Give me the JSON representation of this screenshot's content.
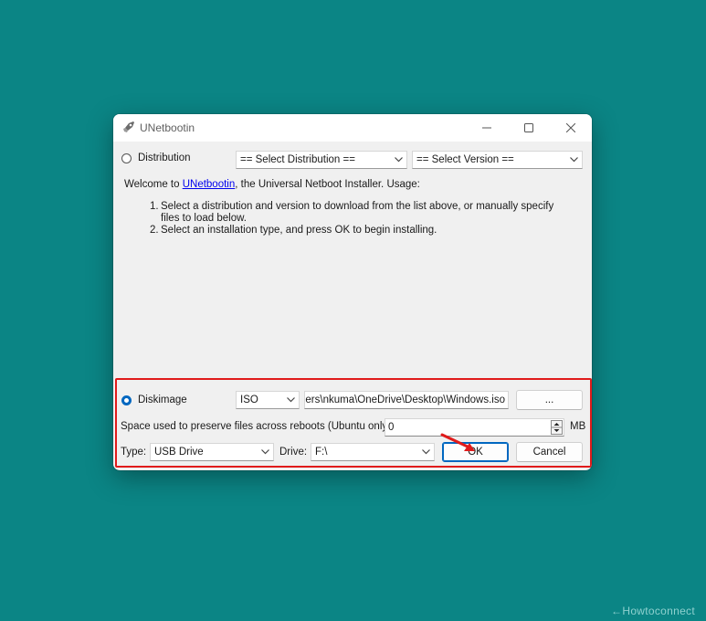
{
  "window": {
    "title": "UNetbootin",
    "icon": "rocket-icon"
  },
  "distribution": {
    "radio_label": "Distribution",
    "select_distribution": "== Select Distribution ==",
    "select_version": "== Select Version =="
  },
  "welcome": {
    "prefix": "Welcome to ",
    "link": "UNetbootin",
    "suffix": ", the Universal Netboot Installer. Usage:",
    "steps": [
      {
        "num": "1.",
        "text": "Select a distribution and version to download from the list above, or manually specify files to load below."
      },
      {
        "num": "2.",
        "text": "Select an installation type, and press OK to begin installing."
      }
    ]
  },
  "diskimage": {
    "radio_label": "Diskimage",
    "format": "ISO",
    "path": "C:\\Users\\nkuma\\OneDrive\\Desktop\\Windows.iso",
    "browse_label": "..."
  },
  "persistence": {
    "label": "Space used to preserve files across reboots (Ubuntu only):",
    "value": "0",
    "unit": "MB"
  },
  "target": {
    "type_label": "Type:",
    "type_value": "USB Drive",
    "drive_label": "Drive:",
    "drive_value": "F:\\"
  },
  "buttons": {
    "ok": "OK",
    "cancel": "Cancel"
  },
  "watermark": "←Howtoconnect",
  "colors": {
    "desktop": "#0b8585",
    "accent": "#0067c0",
    "highlight": "#e01b1b"
  }
}
